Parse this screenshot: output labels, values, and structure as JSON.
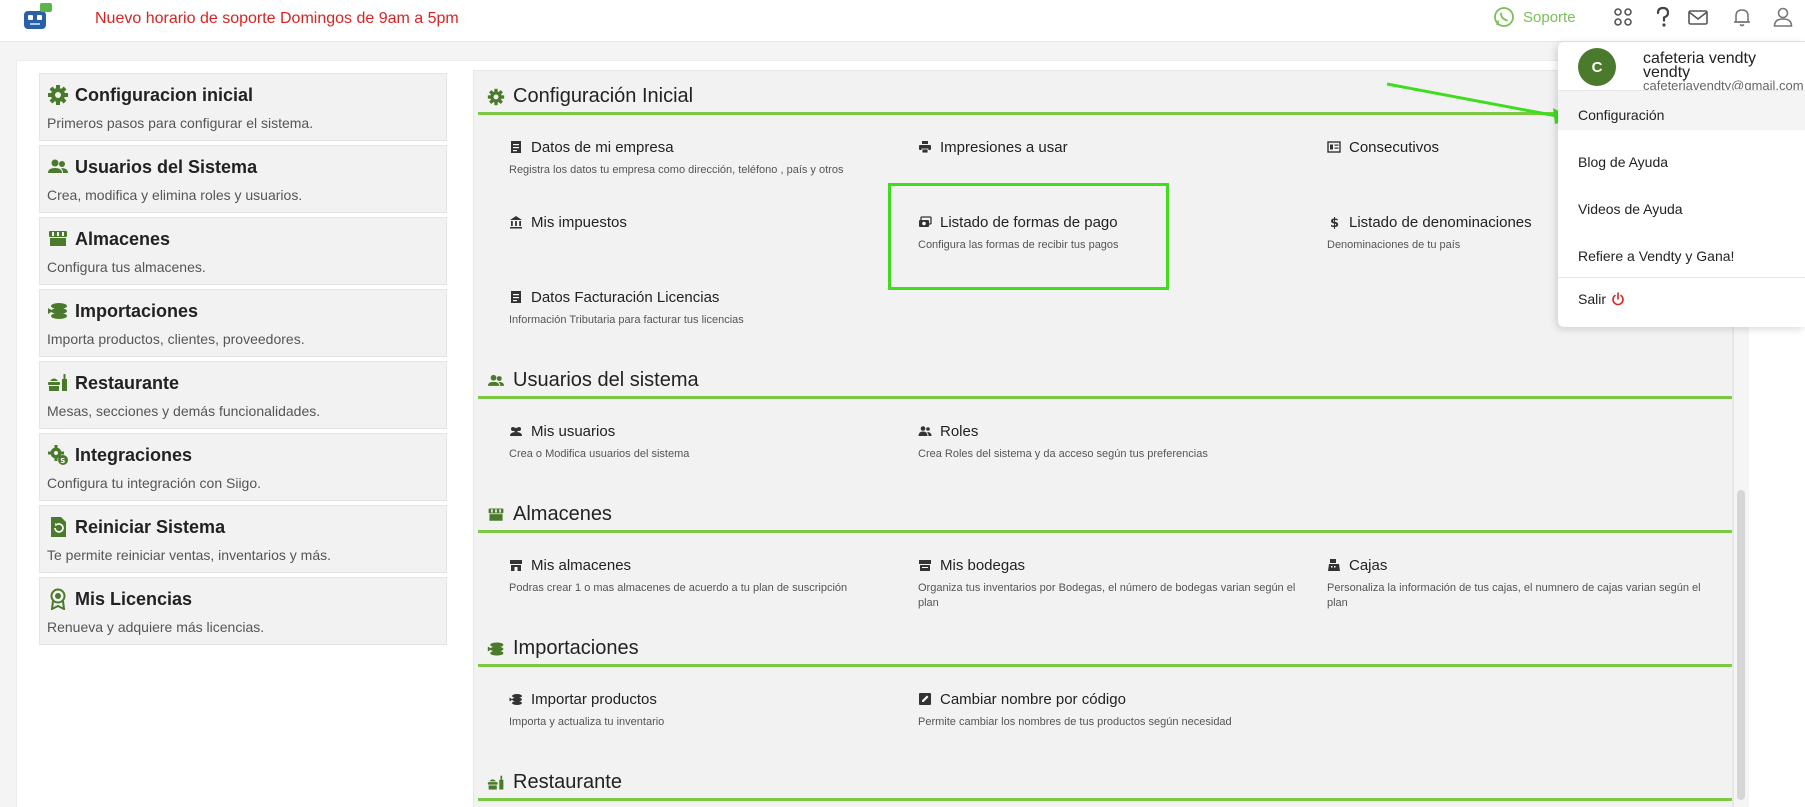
{
  "topbar": {
    "announcement": "Nuevo horario de soporte Domingos de 9am a 5pm",
    "support_label": "Soporte",
    "icons": [
      "whatsapp-icon",
      "apps-grid-icon",
      "help-icon",
      "mail-icon",
      "bell-icon",
      "user-icon"
    ]
  },
  "left_menu": [
    {
      "icon": "gear-icon",
      "title": "Configuracion inicial",
      "desc": "Primeros pasos para configurar el sistema."
    },
    {
      "icon": "users-icon",
      "title": "Usuarios del Sistema",
      "desc": "Crea, modifica y elimina roles y usuarios."
    },
    {
      "icon": "store-icon",
      "title": "Almacenes",
      "desc": "Configura tus almacenes."
    },
    {
      "icon": "import-icon",
      "title": "Importaciones",
      "desc": "Importa productos, clientes, proveedores."
    },
    {
      "icon": "restaurant-icon",
      "title": "Restaurante",
      "desc": "Mesas, secciones y demás funcionalidades."
    },
    {
      "icon": "integration-icon",
      "title": "Integraciones",
      "desc": "Configura tu integración con Siigo."
    },
    {
      "icon": "reset-icon",
      "title": "Reiniciar Sistema",
      "desc": "Te permite reiniciar ventas, inventarios y más."
    },
    {
      "icon": "license-icon",
      "title": "Mis Licencias",
      "desc": "Renueva y adquiere más licencias."
    }
  ],
  "sections": {
    "config": {
      "title": "Configuración Inicial",
      "cards": [
        {
          "title": "Datos de mi empresa",
          "desc": "Registra los datos tu empresa como dirección, teléfono , país y otros"
        },
        {
          "title": "Impresiones a usar",
          "desc": ""
        },
        {
          "title": "Consecutivos",
          "desc": ""
        },
        {
          "title": "Mis impuestos",
          "desc": ""
        },
        {
          "title": "Listado de formas de pago",
          "desc": "Configura las formas de recibir tus pagos"
        },
        {
          "title": "Listado de denominaciones",
          "desc": "Denominaciones de tu país"
        },
        {
          "title": "Datos Facturación Licencias",
          "desc": "Información Tributaria para facturar tus licencias"
        }
      ]
    },
    "users": {
      "title": "Usuarios del sistema",
      "cards": [
        {
          "title": "Mis usuarios",
          "desc": "Crea o Modifica usuarios del sistema"
        },
        {
          "title": "Roles",
          "desc": "Crea Roles del sistema y da acceso según tus preferencias"
        }
      ]
    },
    "stores": {
      "title": "Almacenes",
      "cards": [
        {
          "title": "Mis almacenes",
          "desc": "Podras crear 1 o mas almacenes de acuerdo a tu plan de suscripción"
        },
        {
          "title": "Mis bodegas",
          "desc": "Organiza tus inventarios por Bodegas, el número de bodegas varian según el plan"
        },
        {
          "title": "Cajas",
          "desc": "Personaliza la información de tus cajas, el numnero de cajas varian según el plan"
        }
      ]
    },
    "imports": {
      "title": "Importaciones",
      "cards": [
        {
          "title": "Importar productos",
          "desc": "Importa y actualiza tu inventario"
        },
        {
          "title": "Cambiar nombre por código",
          "desc": "Permite cambiar los nombres de tus productos según necesidad"
        }
      ]
    },
    "restaurant": {
      "title": "Restaurante"
    }
  },
  "user_menu": {
    "avatar_letter": "C",
    "name": "cafeteria vendty vendty",
    "name_line1": "cafeteria vendty",
    "name_line2": "vendty",
    "email": "cafeteriavendty@gmail.com",
    "items": [
      "Configuración",
      "Blog de Ayuda",
      "Videos de Ayuda",
      "Refiere a Vendty y Gana!",
      "Salir"
    ]
  },
  "colors": {
    "accent_green": "#7bc943",
    "highlight_green": "#3ede1e",
    "alert_red": "#e02020",
    "avatar_green": "#4a7a2c",
    "icon_green": "#4a7a2c"
  }
}
